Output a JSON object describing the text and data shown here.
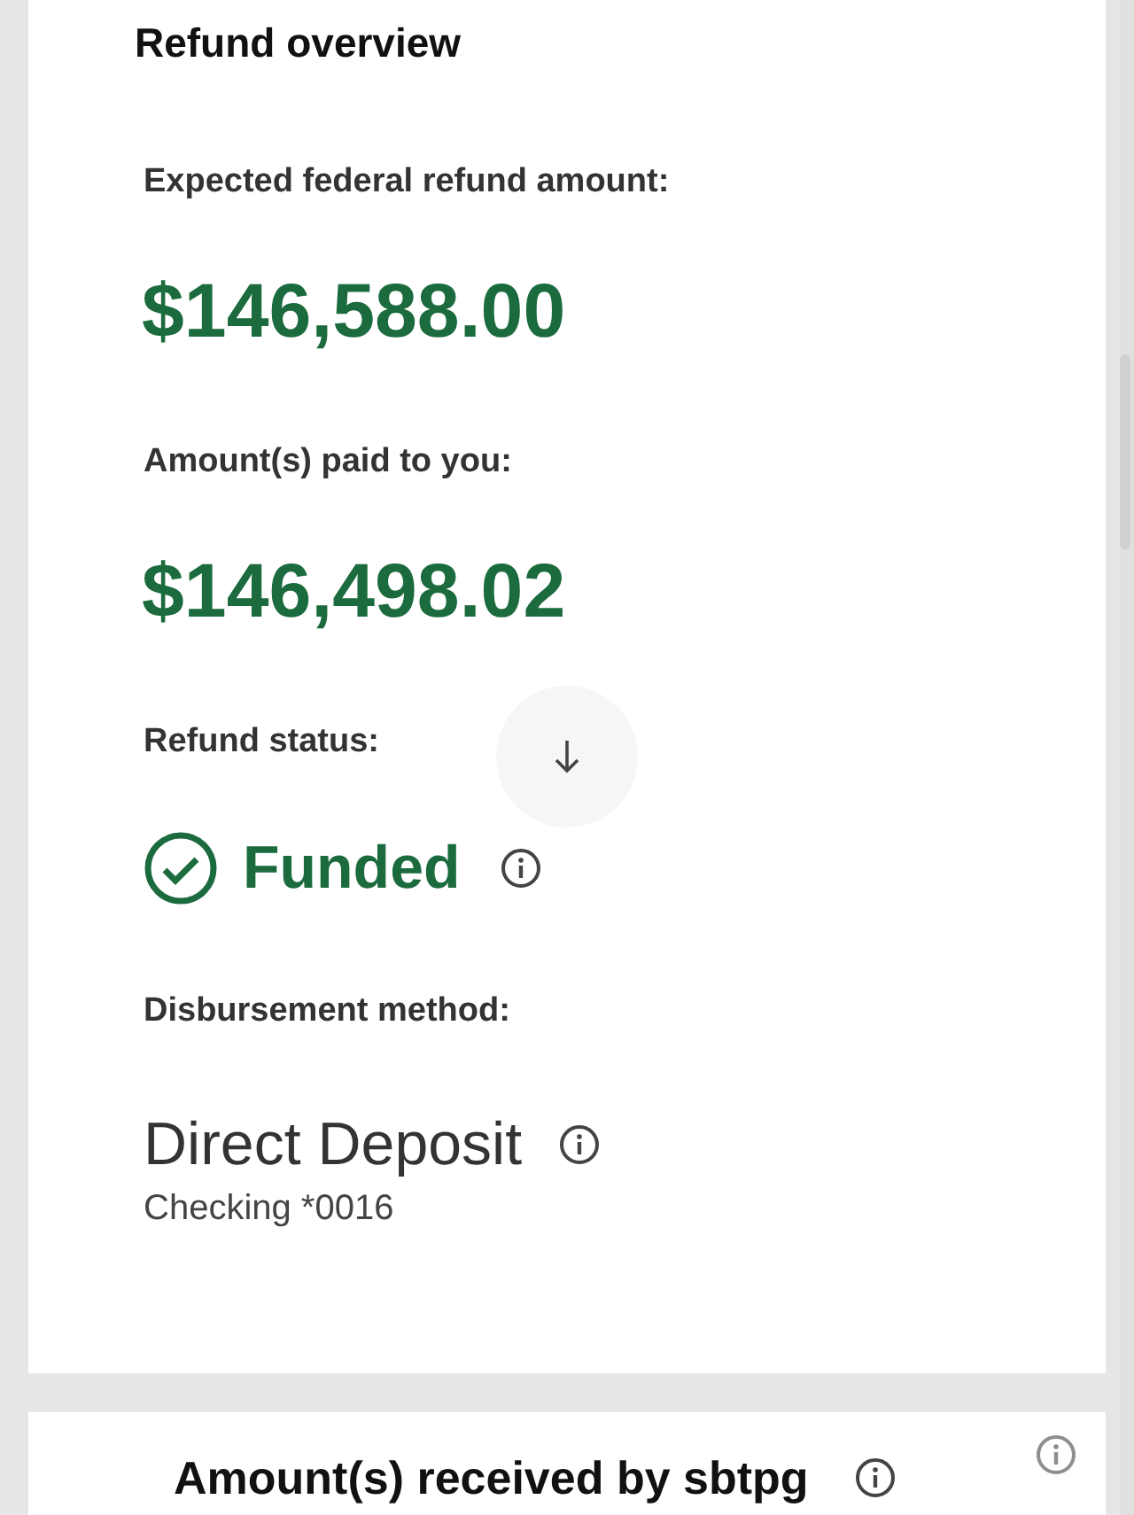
{
  "refund_overview": {
    "title": "Refund overview",
    "fields": [
      {
        "kind": "amount",
        "label": "Expected federal refund amount:",
        "value": "$146,588.00"
      },
      {
        "kind": "amount",
        "label": "Amount(s) paid to you:",
        "value": "$146,498.02"
      },
      {
        "kind": "status",
        "label": "Refund status:",
        "value": "Funded"
      },
      {
        "kind": "method",
        "label": "Disbursement method:",
        "value": "Direct Deposit",
        "detail": "Checking *0016"
      }
    ]
  },
  "received_card": {
    "title": "Amount(s) received by sbtpg"
  }
}
